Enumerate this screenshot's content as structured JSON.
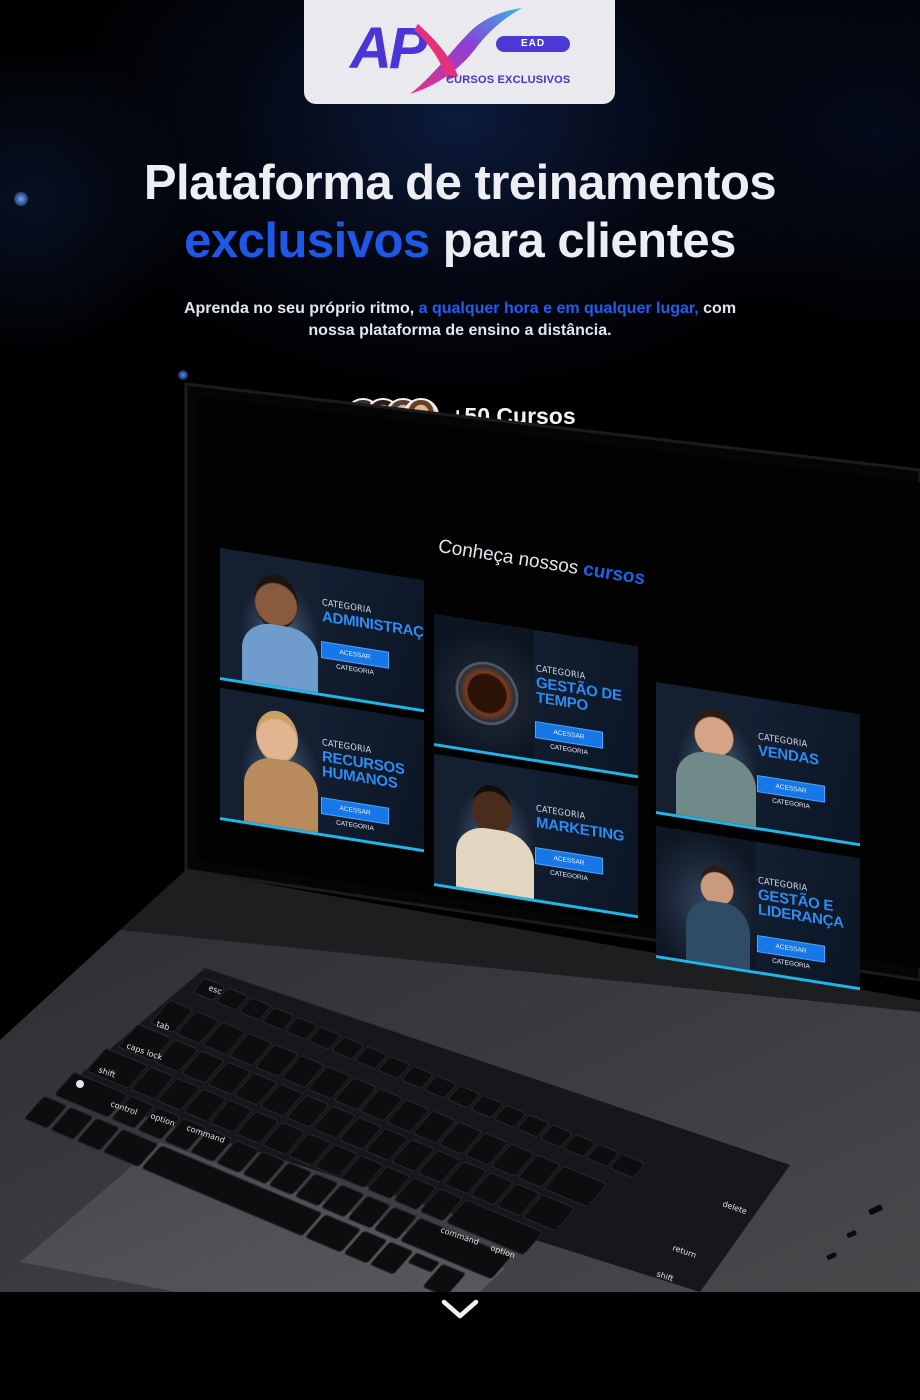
{
  "logo": {
    "mark": "AP",
    "ead": "EAD",
    "tagline": "CURSOS EXCLUSIVOS",
    "colors": {
      "brand": "#4a35d8",
      "swoosh_pink": "#e6307e",
      "swoosh_cyan": "#35b6e8"
    }
  },
  "hero": {
    "title_line1": "Plataforma de treinamentos",
    "title_accent": "exclusivos",
    "title_line2_rest": " para clientes",
    "sub_part1": "Aprenda no seu próprio ritmo, ",
    "sub_accent": "a qualquer hora e em qualquer lugar,",
    "sub_part2": " com nossa plataforma de ensino a distância."
  },
  "courses_badge": {
    "label": "+50 Cursos",
    "avatar_count": 4
  },
  "screen": {
    "heading_prefix": "Conheça nossos ",
    "heading_accent": "cursos",
    "cards": [
      {
        "category_label": "CATEGORIA",
        "name": "ADMINISTRAÇÃO",
        "button": "ACESSAR CATEGORIA"
      },
      {
        "category_label": "CATEGORIA",
        "name": "RECURSOS HUMANOS",
        "button": "ACESSAR CATEGORIA"
      },
      {
        "category_label": "CATEGORIA",
        "name": "GESTÃO DE TEMPO",
        "button": "ACESSAR CATEGORIA"
      },
      {
        "category_label": "CATEGORIA",
        "name": "MARKETING",
        "button": "ACESSAR CATEGORIA"
      },
      {
        "category_label": "CATEGORIA",
        "name": "VENDAS",
        "button": "ACESSAR CATEGORIA"
      },
      {
        "category_label": "CATEGORIA",
        "name": "GESTÃO E LIDERANÇA",
        "button": "ACESSAR CATEGORIA"
      }
    ]
  },
  "keyboard": {
    "keys": [
      "esc",
      "tab",
      "caps lock",
      "shift",
      "control",
      "option",
      "command",
      "return",
      "delete",
      "shift",
      "command",
      "option"
    ]
  },
  "scroll_icon": "chevron-down-icon",
  "colors": {
    "accent": "#1f57e6",
    "card_line": "#1fb6e8"
  }
}
